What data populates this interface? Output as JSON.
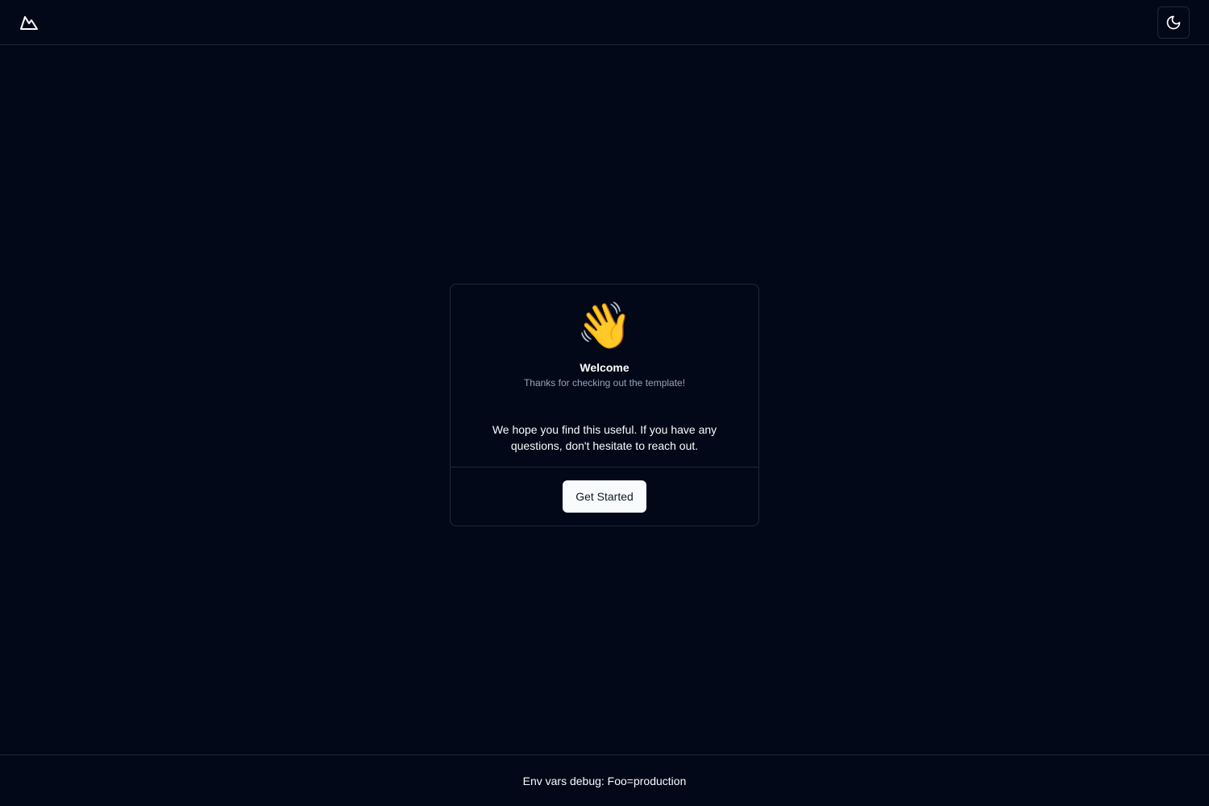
{
  "header": {
    "logo_icon": "mountain-logo-icon",
    "theme_toggle_icon": "moon-icon"
  },
  "card": {
    "emoji": "👋",
    "emoji_icon": "waving-hand-icon",
    "title": "Welcome",
    "subtitle": "Thanks for checking out the template!",
    "body": "We hope you find this useful. If you have any questions, don't hesitate to reach out.",
    "button_label": "Get Started"
  },
  "footer": {
    "text": "Env vars debug: Foo=production"
  },
  "colors": {
    "background": "#020817",
    "border": "#1e293b",
    "foreground": "#f8fafc",
    "muted": "#94a3b8",
    "button_bg": "#f8fafc",
    "button_text": "#0f172a"
  }
}
